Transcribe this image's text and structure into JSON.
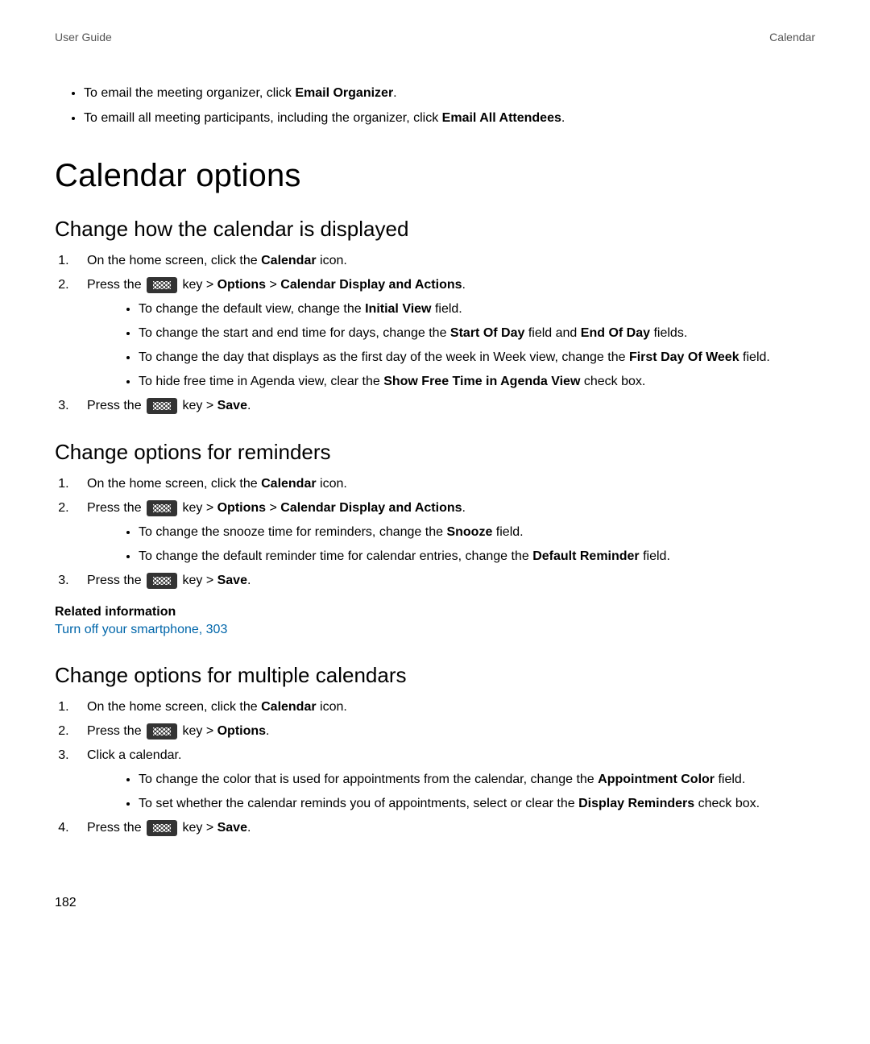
{
  "header": {
    "left": "User Guide",
    "right": "Calendar"
  },
  "intro_bullets": [
    {
      "pre": "To email the meeting organizer, click ",
      "bold": "Email Organizer",
      "post": "."
    },
    {
      "pre": "To emaill all meeting participants, including the organizer, click ",
      "bold": "Email All Attendees",
      "post": "."
    }
  ],
  "h1": "Calendar options",
  "section_display": {
    "heading": "Change how the calendar is displayed",
    "step1_pre": "On the home screen, click the ",
    "step1_bold": "Calendar",
    "step1_post": " icon.",
    "step2_pre": "Press the ",
    "step2_mid": " key > ",
    "step2_b1": "Options",
    "step2_sep": " > ",
    "step2_b2": "Calendar Display and Actions",
    "step2_post": ".",
    "bullets": [
      {
        "pre": "To change the default view, change the ",
        "bold": "Initial View",
        "post": " field."
      },
      {
        "pre": "To change the start and end time for days, change the ",
        "bold": "Start Of Day",
        "mid": " field and ",
        "bold2": "End Of Day",
        "post": " fields."
      },
      {
        "pre": "To change the day that displays as the first day of the week in Week view, change the ",
        "bold": "First Day Of Week",
        "post": " field."
      },
      {
        "pre": "To hide free time in Agenda view, clear the ",
        "bold": "Show Free Time in Agenda View",
        "post": " check box."
      }
    ],
    "step3_pre": "Press the ",
    "step3_mid": " key > ",
    "step3_bold": "Save",
    "step3_post": "."
  },
  "section_reminders": {
    "heading": "Change options for reminders",
    "step1_pre": "On the home screen, click the ",
    "step1_bold": "Calendar",
    "step1_post": " icon.",
    "step2_pre": "Press the ",
    "step2_mid": " key > ",
    "step2_b1": "Options",
    "step2_sep": " > ",
    "step2_b2": "Calendar Display and Actions",
    "step2_post": ".",
    "bullets": [
      {
        "pre": "To change the snooze time for reminders, change the ",
        "bold": "Snooze",
        "post": " field."
      },
      {
        "pre": "To change the default reminder time for calendar entries, change the ",
        "bold": "Default Reminder",
        "post": " field."
      }
    ],
    "step3_pre": "Press the ",
    "step3_mid": " key > ",
    "step3_bold": "Save",
    "step3_post": ".",
    "related_heading": "Related information",
    "related_link_text": "Turn off your smartphone, ",
    "related_link_page": "303"
  },
  "section_multiple": {
    "heading": "Change options for multiple calendars",
    "step1_pre": "On the home screen, click the ",
    "step1_bold": "Calendar",
    "step1_post": " icon.",
    "step2_pre": "Press the ",
    "step2_mid": " key > ",
    "step2_bold": "Options",
    "step2_post": ".",
    "step3": "Click a calendar.",
    "bullets": [
      {
        "pre": "To change the color that is used for appointments from the calendar, change the ",
        "bold": "Appointment Color",
        "post": " field."
      },
      {
        "pre": "To set whether the calendar reminds you of appointments, select or clear the ",
        "bold": "Display Reminders",
        "post": " check box."
      }
    ],
    "step4_pre": "Press the ",
    "step4_mid": " key > ",
    "step4_bold": "Save",
    "step4_post": "."
  },
  "page_number": "182"
}
